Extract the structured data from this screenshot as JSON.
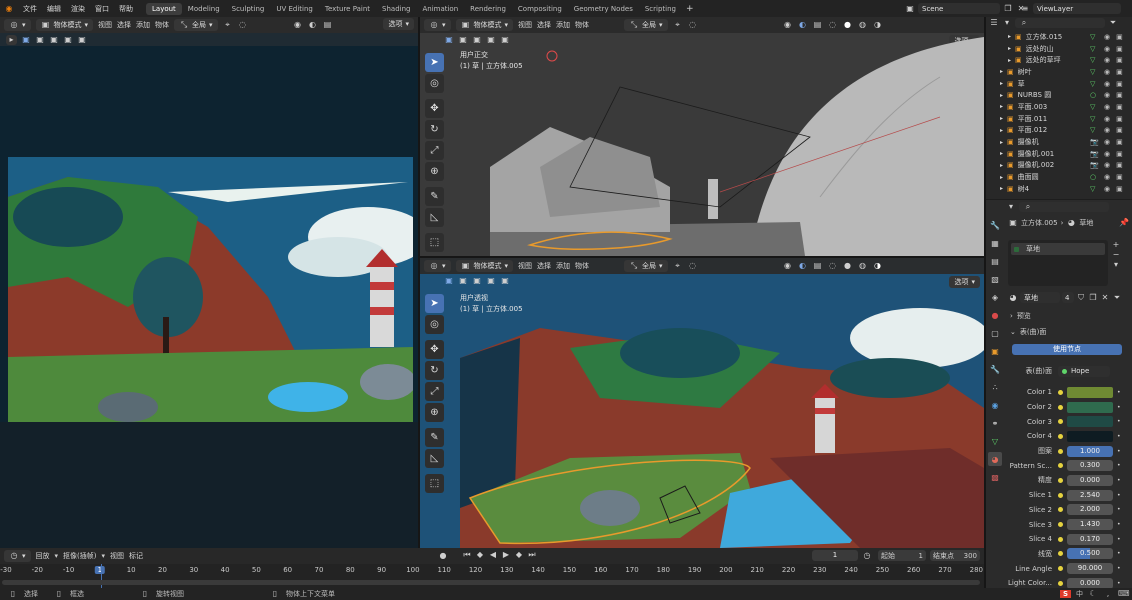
{
  "app_menu": [
    "文件",
    "编辑",
    "渲染",
    "窗口",
    "帮助"
  ],
  "workspaces": [
    "Layout",
    "Modeling",
    "Sculpting",
    "UV Editing",
    "Texture Paint",
    "Shading",
    "Animation",
    "Rendering",
    "Compositing",
    "Geometry Nodes",
    "Scripting"
  ],
  "active_workspace": "Layout",
  "add_workspace": "+",
  "scene": "Scene",
  "view_layer": "ViewLayer",
  "left_view": {
    "mode": "物体模式",
    "menus": [
      "视图",
      "选择",
      "添加",
      "物体"
    ],
    "transform": "全局",
    "options": "选项"
  },
  "top_view": {
    "mode": "物体模式",
    "menus": [
      "视图",
      "选择",
      "添加",
      "物体"
    ],
    "transform": "全局",
    "options": "选项",
    "view_name": "用户正交",
    "object_info": "(1) 草 | 立方体.005"
  },
  "bottom_view": {
    "mode": "物体模式",
    "menus": [
      "视图",
      "选择",
      "添加",
      "物体"
    ],
    "transform": "全局",
    "options": "选项",
    "view_name": "用户透视",
    "object_info": "(1) 草 | 立方体.005"
  },
  "outliner": {
    "search_placeholder": "",
    "items": [
      {
        "name": "立方体.015",
        "indent": 2
      },
      {
        "name": "远处的山",
        "indent": 2
      },
      {
        "name": "远处的草坪",
        "indent": 2
      },
      {
        "name": "树叶",
        "indent": 1
      },
      {
        "name": "草",
        "indent": 1
      },
      {
        "name": "NURBS 圆",
        "indent": 1
      },
      {
        "name": "平面.003",
        "indent": 1
      },
      {
        "name": "平面.011",
        "indent": 1
      },
      {
        "name": "平面.012",
        "indent": 1
      },
      {
        "name": "摄像机",
        "indent": 1
      },
      {
        "name": "摄像机.001",
        "indent": 1
      },
      {
        "name": "摄像机.002",
        "indent": 1
      },
      {
        "name": "曲面圆",
        "indent": 1
      },
      {
        "name": "树4",
        "indent": 1
      }
    ]
  },
  "properties": {
    "breadcrumb_object": "立方体.005",
    "breadcrumb_material": "草地",
    "material_slot": "草地",
    "material_name": "草地",
    "user_count": "4",
    "sections": {
      "preview": "预览",
      "surface": "表(曲)面"
    },
    "use_nodes": "使用节点",
    "surface_label": "表(曲)面",
    "surface_value": "Hope",
    "rows": [
      {
        "label": "Color 1",
        "type": "color",
        "color": "#6f8a33"
      },
      {
        "label": "Color 2",
        "type": "color",
        "color": "#2f6b4e"
      },
      {
        "label": "Color 3",
        "type": "color",
        "color": "#1f4a45"
      },
      {
        "label": "Color 4",
        "type": "color",
        "color": "#0e1c22"
      },
      {
        "label": "图案",
        "type": "num",
        "value": "1.000",
        "selected": true
      },
      {
        "label": "Pattern Sc...",
        "type": "num",
        "value": "0.300"
      },
      {
        "label": "精度",
        "type": "num",
        "value": "0.000"
      },
      {
        "label": "Slice 1",
        "type": "num",
        "value": "2.540"
      },
      {
        "label": "Slice 2",
        "type": "num",
        "value": "2.000"
      },
      {
        "label": "Slice 3",
        "type": "num",
        "value": "1.430"
      },
      {
        "label": "Slice 4",
        "type": "num",
        "value": "0.170"
      },
      {
        "label": "线宽",
        "type": "num",
        "value": "0.500",
        "half": true
      },
      {
        "label": "Line Angle",
        "type": "num",
        "value": "90.000"
      },
      {
        "label": "Light Color...",
        "type": "num",
        "value": "0.000"
      }
    ]
  },
  "timeline": {
    "menus": [
      "回放",
      "抠像(插帧)",
      "视图",
      "标记"
    ],
    "current_frame": "1",
    "start_label": "起始",
    "start": "1",
    "end_label": "结束点",
    "end": "300",
    "ticks": [
      "-30",
      "-20",
      "-10",
      "1",
      "10",
      "20",
      "30",
      "40",
      "50",
      "60",
      "70",
      "80",
      "90",
      "100",
      "110",
      "120",
      "130",
      "140",
      "150",
      "160",
      "170",
      "180",
      "190",
      "200",
      "210",
      "220",
      "230",
      "240",
      "250",
      "260",
      "270",
      "280"
    ]
  },
  "status": {
    "select": "选择",
    "box": "框选",
    "rotate": "旋转视图",
    "context": "物体上下文菜单"
  },
  "tray": {
    "ime": "中"
  }
}
